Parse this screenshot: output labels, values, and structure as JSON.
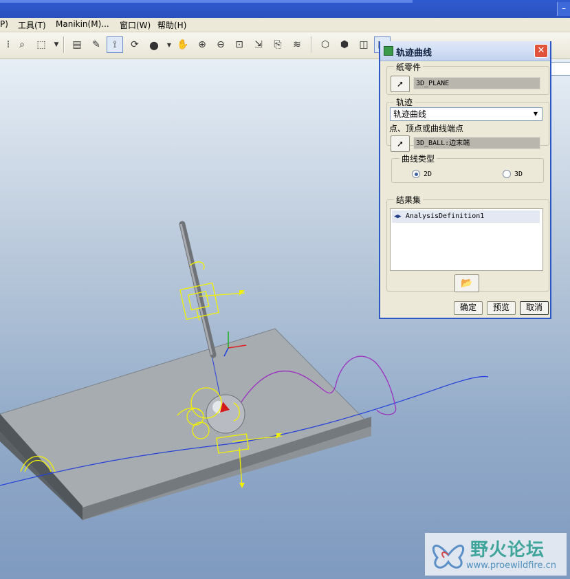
{
  "menu": [
    {
      "label": "P)"
    },
    {
      "label": "工具(T)"
    },
    {
      "label": "Manikin(M)..."
    },
    {
      "label": "窗口(W)"
    },
    {
      "label": "帮助(H)"
    }
  ],
  "toolbar": {
    "icons": [
      "view-icon",
      "binoculars-icon",
      "select-box-icon",
      "layers-icon",
      "sketch-icon",
      "datum-display-icon",
      "spin-center-icon",
      "shade-icon",
      "pan-hand-icon",
      "zoom-in-icon",
      "zoom-out-icon",
      "refit-icon",
      "orient-icon",
      "named-view-icon",
      "layer-tree-icon",
      "wireframe-icon",
      "hidden-line-icon",
      "no-hidden-icon",
      "shading-icon"
    ]
  },
  "dialog": {
    "title": "轨迹曲线",
    "close_label": "✕",
    "paper_part": {
      "legend": "纸零件",
      "value": "3D_PLANE"
    },
    "trajectory": {
      "legend": "轨迹",
      "selected": "轨迹曲线",
      "point_label": "点、顶点或曲线端点",
      "point_value": "3D_BALL:边末端"
    },
    "curve_type": {
      "legend": "曲线类型",
      "options": [
        "2D",
        "3D"
      ],
      "selected": "2D"
    },
    "result_set": {
      "legend": "结果集",
      "items": [
        "AnalysisDefinition1"
      ]
    },
    "buttons": {
      "ok": "确定",
      "preview": "预览",
      "cancel": "取消"
    }
  },
  "watermark": {
    "title": "野火论坛",
    "url": "www.proewildfire.cn"
  },
  "colors": {
    "accent": "#2c56c5",
    "trajectory": "#9b30c0",
    "axis": "#2040d0",
    "mechanism": "#f2f200"
  }
}
